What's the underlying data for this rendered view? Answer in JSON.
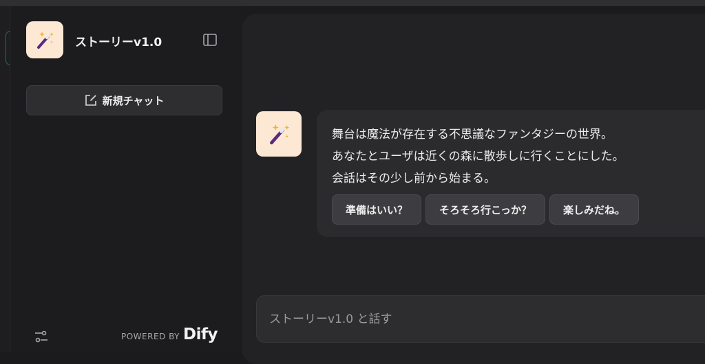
{
  "app": {
    "title": "ストーリーv1.0"
  },
  "sidebar": {
    "new_chat_label": "新規チャット",
    "powered_by": "POWERED BY",
    "brand": "Dify"
  },
  "chat": {
    "opening_lines": [
      "舞台は魔法が存在する不思議なファンタジーの世界。",
      "あなたとユーザは近くの森に散歩しに行くことにした。",
      "会話はその少し前から始まる。"
    ],
    "suggestions": [
      "準備はいい？",
      "そろそろ行こっか？",
      "楽しみだね。"
    ]
  },
  "composer": {
    "placeholder": "ストーリーv1.0 と話す"
  },
  "icons": {
    "app": "magic-wand-icon",
    "sidebar_toggle": "panel-toggle-icon",
    "new_chat": "edit-icon",
    "settings": "sliders-icon"
  },
  "colors": {
    "background": "#1b1b1d",
    "panel": "#222224",
    "icon_bg": "#fde8d4"
  }
}
